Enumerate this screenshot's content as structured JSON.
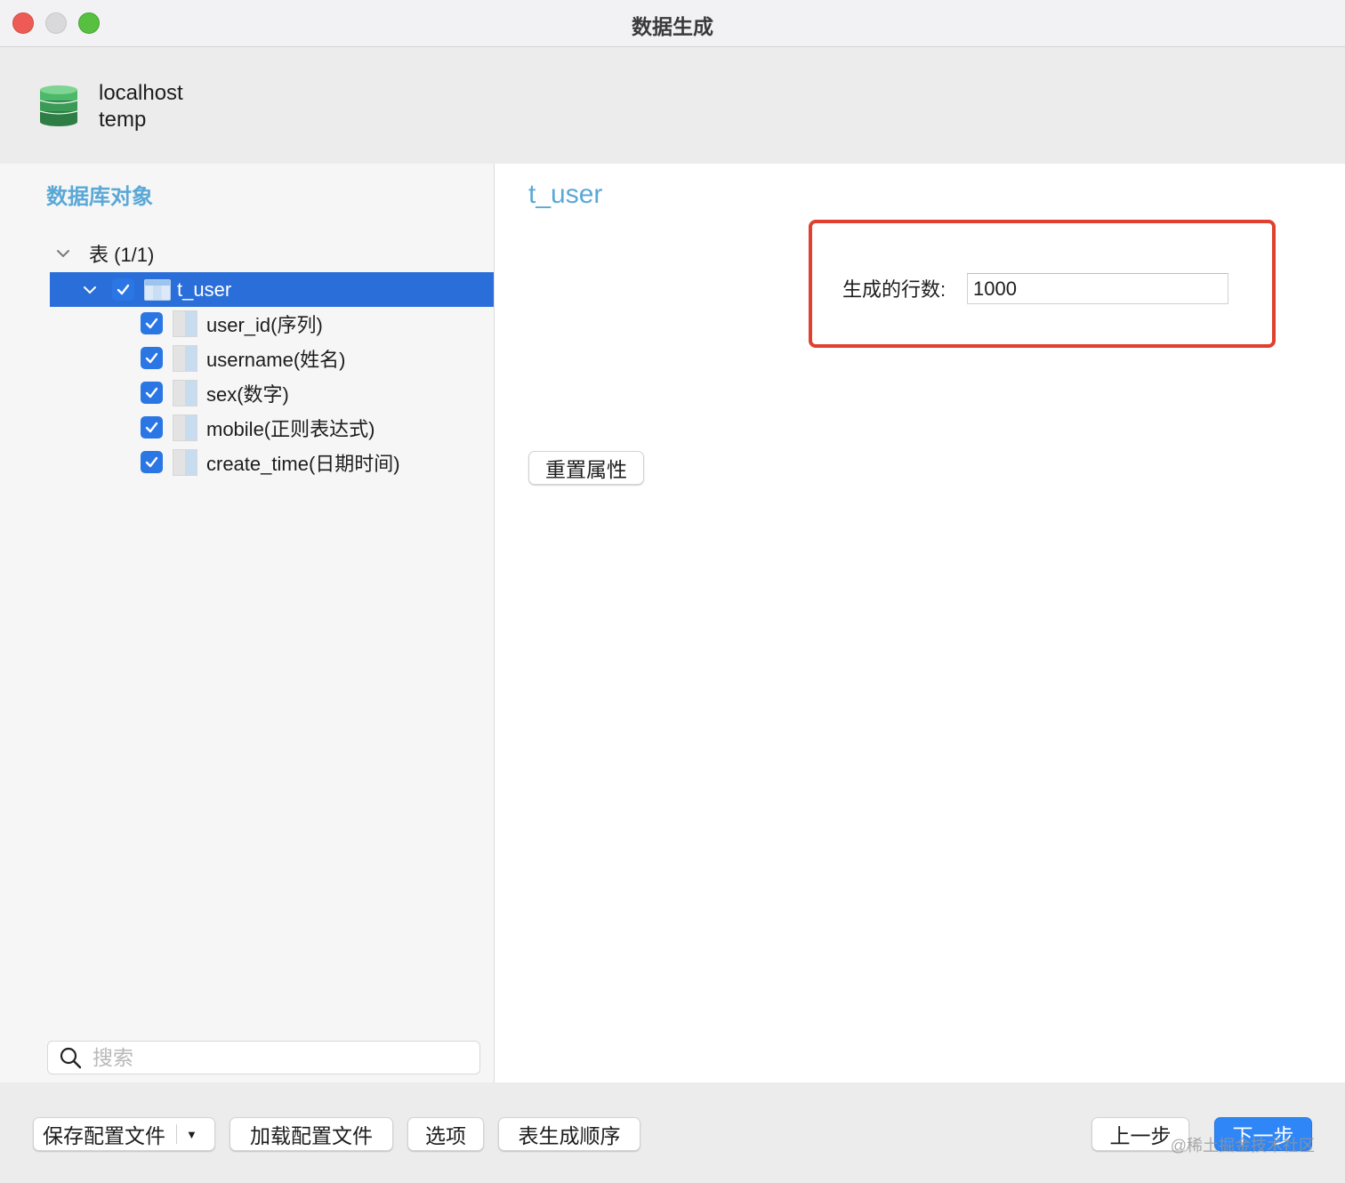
{
  "window": {
    "title": "数据生成"
  },
  "connection": {
    "server": "localhost",
    "database": "temp",
    "icon": "database-icon",
    "icon_color": "#3fa45b"
  },
  "left_panel": {
    "heading": "数据库对象",
    "group": {
      "label": "表 (1/1)",
      "expanded": true
    },
    "table": {
      "name": "t_user",
      "checked": true,
      "selected": true
    },
    "columns": [
      {
        "label": "user_id(序列)",
        "checked": true
      },
      {
        "label": "username(姓名)",
        "checked": true
      },
      {
        "label": "sex(数字)",
        "checked": true
      },
      {
        "label": "mobile(正则表达式)",
        "checked": true
      },
      {
        "label": "create_time(日期时间)",
        "checked": true
      }
    ],
    "search": {
      "placeholder": "搜索",
      "value": ""
    }
  },
  "right_panel": {
    "table_title": "t_user",
    "rows_label": "生成的行数:",
    "rows_value": "1000",
    "reset_button": "重置属性",
    "highlight_color": "#e0402e"
  },
  "footer": {
    "save_config": "保存配置文件",
    "load_config": "加载配置文件",
    "options": "选项",
    "table_order": "表生成顺序",
    "prev": "上一步",
    "next": "下一步",
    "watermark": "@稀土掘金技术社区"
  },
  "colors": {
    "accent": "#2a6ed9",
    "heading": "#5aa8d6",
    "checkbox": "#2b76e5"
  }
}
